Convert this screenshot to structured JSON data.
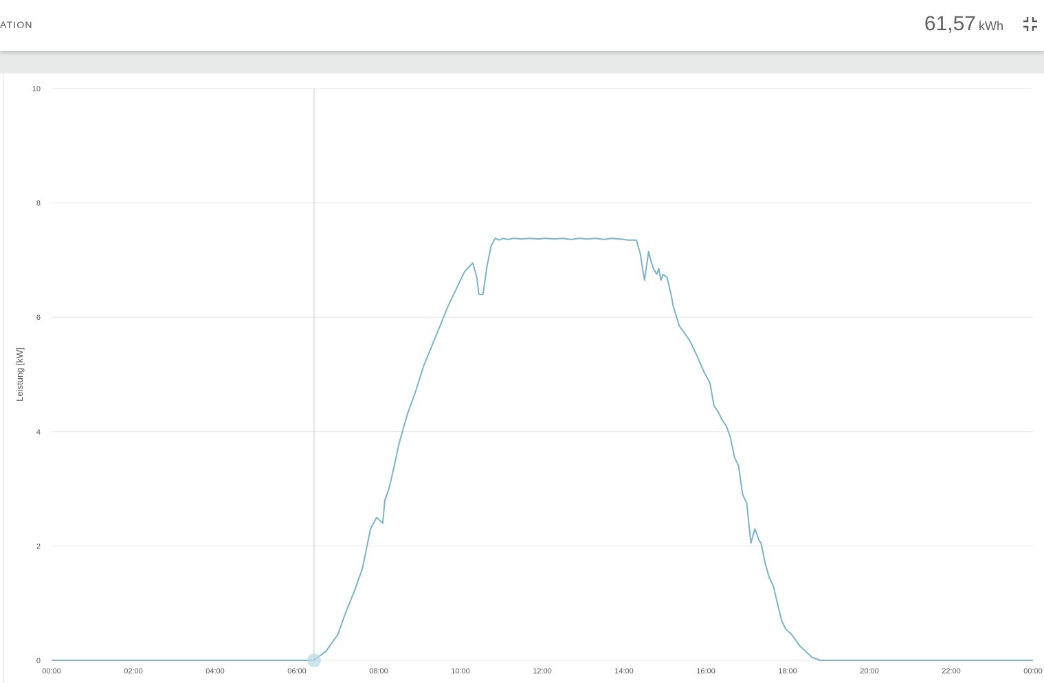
{
  "header": {
    "title": "ATION",
    "total_value": "61,57",
    "total_unit": "kWh",
    "collapse_icon": "collapse-icon"
  },
  "colors": {
    "line": "#79b4c9",
    "grid": "#e6e6e6",
    "cursor": "#c8c8c8",
    "marker": "#b7d9e6"
  },
  "chart_data": {
    "type": "line",
    "ylabel": "Leistung [kW]",
    "xlabel": "",
    "ylim": [
      0,
      10
    ],
    "xlim": [
      0,
      24
    ],
    "y_ticks": [
      0,
      2,
      4,
      6,
      8,
      10
    ],
    "x_tick_labels": [
      "00:00",
      "02:00",
      "04:00",
      "06:00",
      "08:00",
      "10:00",
      "12:00",
      "14:00",
      "16:00",
      "18:00",
      "20:00",
      "22:00",
      "00:00"
    ],
    "grid": true,
    "cursor_x": 6.42,
    "series": [
      {
        "x": [
          0,
          6.4,
          6.5,
          6.7,
          6.9,
          7.0,
          7.2,
          7.4,
          7.6,
          7.8,
          7.95,
          8.1,
          8.15,
          8.25,
          8.35,
          8.5,
          8.7,
          8.9,
          9.1,
          9.3,
          9.5,
          9.7,
          9.9,
          10.1,
          10.3,
          10.4,
          10.45,
          10.55,
          10.65,
          10.75,
          10.85,
          10.95,
          11.05,
          11.15,
          11.3,
          11.5,
          11.7,
          11.9,
          12.1,
          12.3,
          12.5,
          12.7,
          12.9,
          13.1,
          13.3,
          13.5,
          13.7,
          13.9,
          14.1,
          14.3,
          14.4,
          14.45,
          14.5,
          14.6,
          14.65,
          14.72,
          14.8,
          14.85,
          14.9,
          14.95,
          15.05,
          15.1,
          15.15,
          15.2,
          15.35,
          15.45,
          15.6,
          15.8,
          15.95,
          16.1,
          16.2,
          16.3,
          16.4,
          16.5,
          16.6,
          16.7,
          16.8,
          16.9,
          17.0,
          17.1,
          17.2,
          17.3,
          17.35,
          17.45,
          17.55,
          17.65,
          17.75,
          17.85,
          17.95,
          18.1,
          18.2,
          18.3,
          18.45,
          18.6,
          18.8,
          18.95,
          19.1,
          19.25,
          19.4,
          19.5,
          19.58,
          19.65,
          20,
          24
        ],
        "y": [
          0,
          0,
          0.05,
          0.15,
          0.35,
          0.45,
          0.85,
          1.2,
          1.6,
          2.3,
          2.5,
          2.4,
          2.8,
          3.0,
          3.3,
          3.8,
          4.3,
          4.7,
          5.15,
          5.5,
          5.85,
          6.2,
          6.5,
          6.8,
          6.95,
          6.7,
          6.4,
          6.4,
          6.9,
          7.25,
          7.38,
          7.35,
          7.38,
          7.36,
          7.38,
          7.37,
          7.38,
          7.37,
          7.38,
          7.37,
          7.38,
          7.36,
          7.38,
          7.37,
          7.38,
          7.36,
          7.38,
          7.37,
          7.35,
          7.35,
          7.1,
          6.85,
          6.65,
          7.15,
          7.0,
          6.85,
          6.75,
          6.85,
          6.65,
          6.75,
          6.7,
          6.55,
          6.4,
          6.2,
          5.85,
          5.75,
          5.6,
          5.3,
          5.05,
          4.85,
          4.45,
          4.35,
          4.2,
          4.1,
          3.9,
          3.55,
          3.4,
          2.9,
          2.75,
          2.05,
          2.3,
          2.1,
          2.05,
          1.7,
          1.45,
          1.3,
          1.0,
          0.7,
          0.55,
          0.45,
          0.35,
          0.25,
          0.15,
          0.05,
          0,
          0,
          0,
          0,
          0,
          0,
          0,
          0,
          0,
          0
        ]
      }
    ]
  }
}
